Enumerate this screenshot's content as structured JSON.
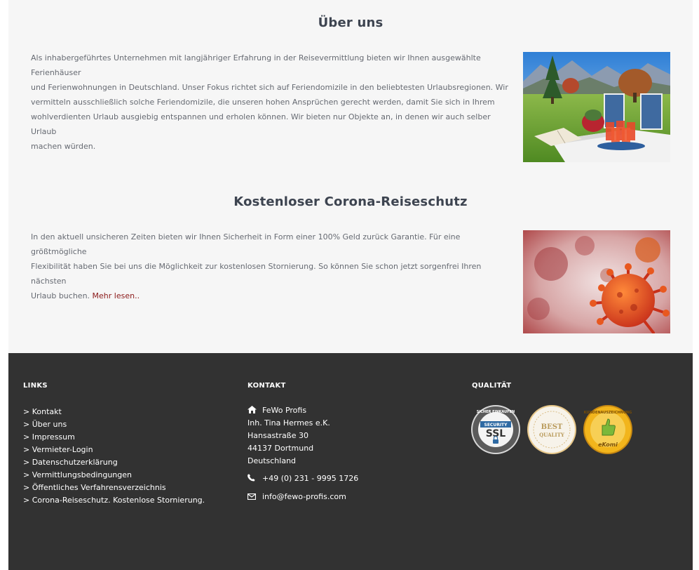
{
  "about": {
    "title": "Über uns",
    "lines": [
      "Als inhabergeführtes Unternehmen mit langjähriger Erfahrung in der Reisevermittlung bieten wir Ihnen ausgewählte Ferienhäuser",
      "und Ferienwohnungen in Deutschland. Unser Fokus richtet sich auf Feriendomizile in den beliebtesten Urlaubsregionen. Wir",
      "vermitteln ausschließlich solche Feriendomizile, die unseren hohen Ansprüchen gerecht werden, damit Sie sich in Ihrem",
      "wohlverdienten Urlaub ausgiebig entspannen und erholen können. Wir bieten nur Objekte an, in denen wir auch selber Urlaub",
      "machen würden."
    ]
  },
  "corona": {
    "title": "Kostenloser Corona-Reiseschutz",
    "lines": [
      "In den aktuell unsicheren Zeiten bieten wir Ihnen Sicherheit in Form einer 100% Geld zurück Garantie. Für eine größtmögliche",
      "Flexibilität haben Sie bei uns die Möglichkeit zur kostenlosen Stornierung. So können Sie schon jetzt sorgenfrei Ihren nächsten"
    ],
    "last_line": "Urlaub buchen.",
    "read_more": "Mehr lesen.."
  },
  "footer": {
    "links_heading": "LINKS",
    "links": [
      "> Kontakt",
      "> Über uns",
      "> Impressum",
      "> Vermieter-Login",
      "> Datenschutzerklärung",
      "> Vermittlungsbedingungen",
      "> Öffentliches Verfahrensverzeichnis",
      "> Corona-Reiseschutz. Kostenlose Stornierung."
    ],
    "contact_heading": "KONTAKT",
    "company": "FeWo Profis",
    "owner": "Inh. Tina Hermes e.K.",
    "street": "Hansastraße 30",
    "city": "44137 Dortmund",
    "country": "Deutschland",
    "phone": "+49 (0) 231 - 9995 1726",
    "email": "info@fewo-profis.com",
    "quality_heading": "QUALITÄT",
    "badges": {
      "ssl_top": "SICHER EINKAUFEN",
      "ssl_security": "SECURITY",
      "ssl_main": "SSL",
      "best_1": "BEST",
      "best_2": "QUALITY",
      "ekomi_ring": "KUNDENAUSZEICHNUNG",
      "ekomi_name": "eKomi"
    }
  },
  "icons": {
    "home": "home-icon",
    "phone": "phone-icon",
    "mail": "envelope-icon"
  },
  "colors": {
    "content_bg": "#f6f6f6",
    "footer_bg": "#323232",
    "title": "#3d4450",
    "text": "#666a72",
    "link": "#8b1a1a"
  }
}
